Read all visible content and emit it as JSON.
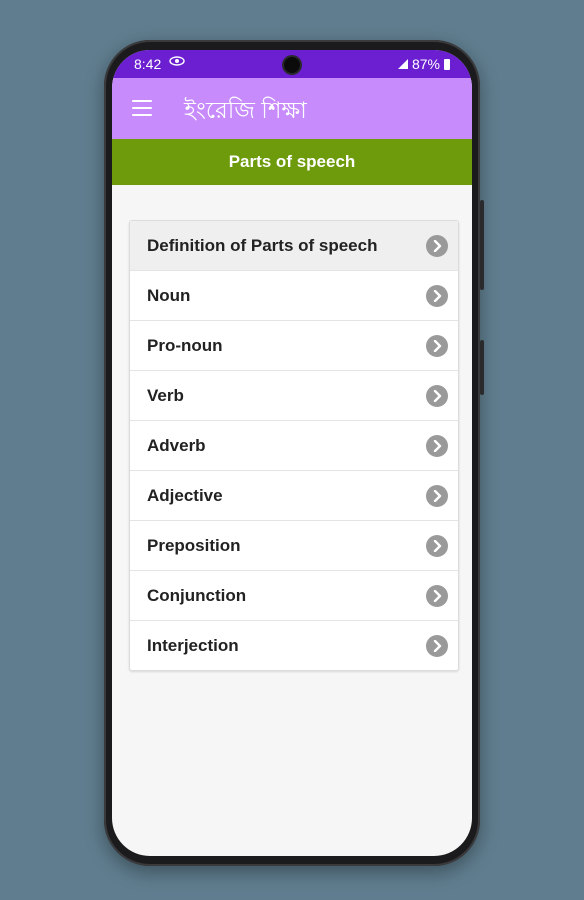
{
  "status_bar": {
    "time": "8:42",
    "battery": "87%",
    "icons": [
      "eye-icon",
      "signal-icon",
      "battery-icon"
    ]
  },
  "app_bar": {
    "title": "ইংরেজি শিক্ষা",
    "menu_icon": "hamburger-menu-icon",
    "color": "#c78bfb"
  },
  "section": {
    "title": "Parts of speech",
    "color": "#6d9b0b"
  },
  "list": {
    "items": [
      {
        "label": "Definition of Parts of speech",
        "icon": "chevron-right-icon"
      },
      {
        "label": "Noun",
        "icon": "chevron-right-icon"
      },
      {
        "label": "Pro-noun",
        "icon": "chevron-right-icon"
      },
      {
        "label": "Verb",
        "icon": "chevron-right-icon"
      },
      {
        "label": "Adverb",
        "icon": "chevron-right-icon"
      },
      {
        "label": "Adjective",
        "icon": "chevron-right-icon"
      },
      {
        "label": "Preposition",
        "icon": "chevron-right-icon"
      },
      {
        "label": "Conjunction",
        "icon": "chevron-right-icon"
      },
      {
        "label": "Interjection",
        "icon": "chevron-right-icon"
      }
    ]
  },
  "colors": {
    "background": "#5f7d8e",
    "status_bar": "#6b1fd1",
    "chevron": "#9a9a9a"
  }
}
